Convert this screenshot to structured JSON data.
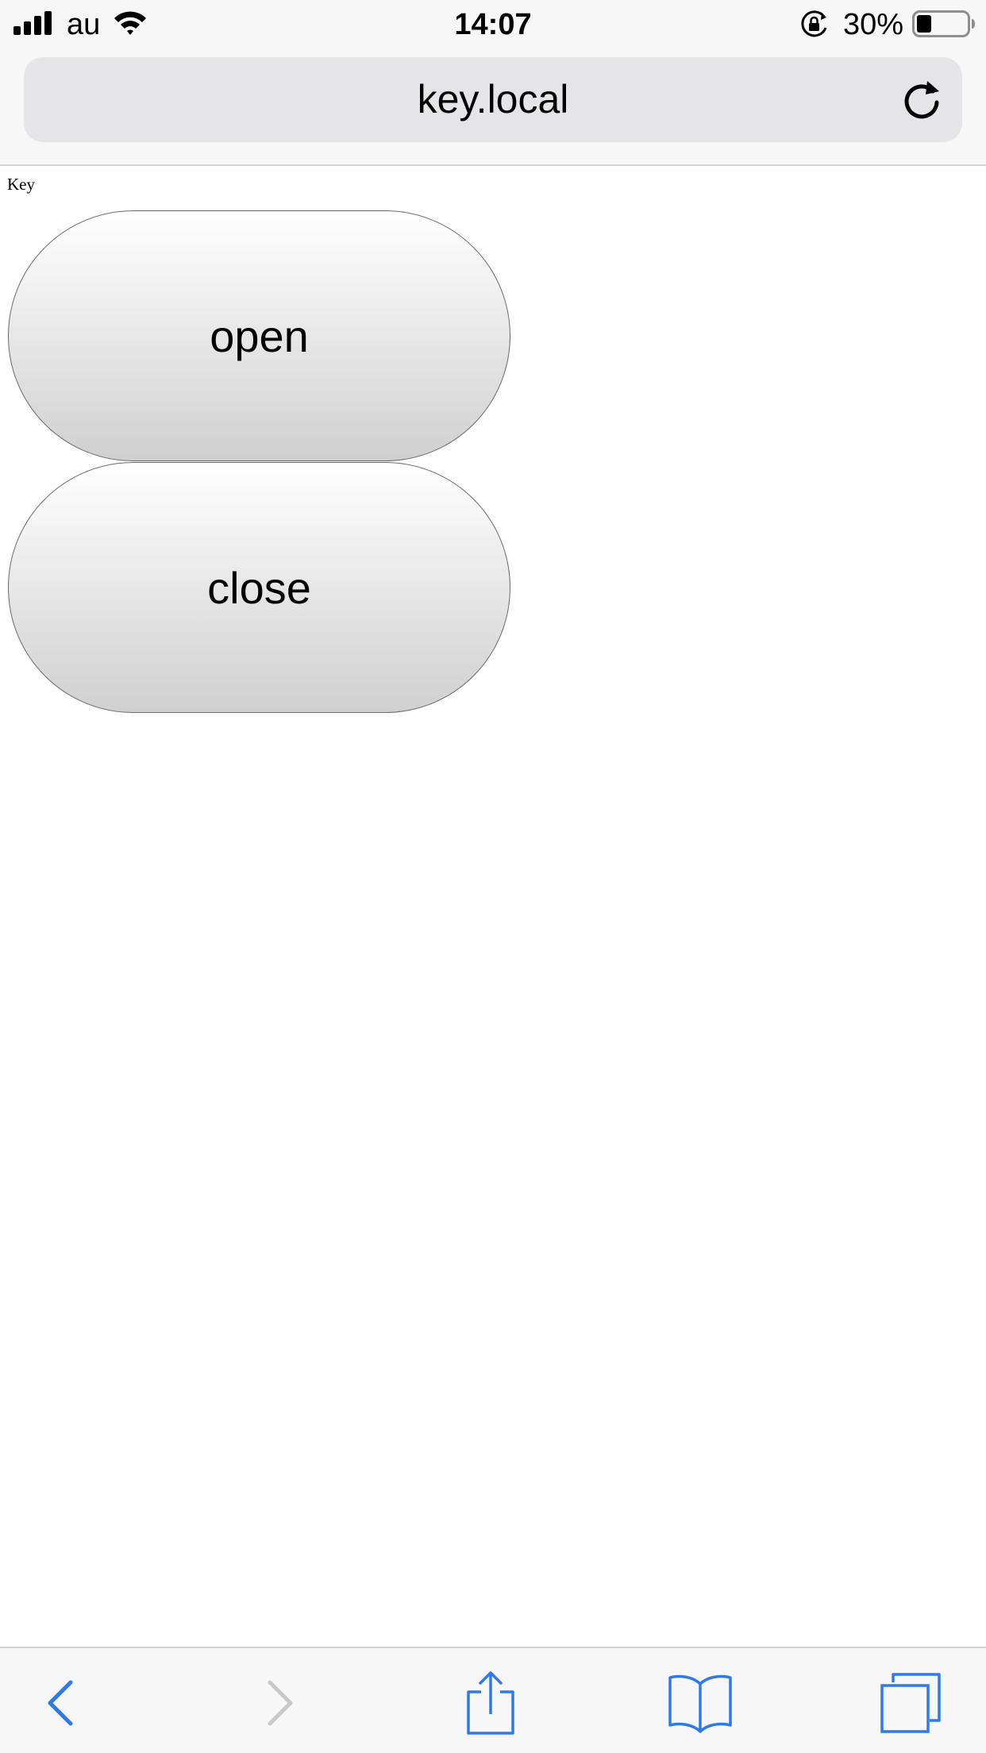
{
  "status_bar": {
    "carrier": "au",
    "time": "14:07",
    "battery_percent": "30%",
    "battery_level": 0.3,
    "icons": [
      "signal-bars-icon",
      "wifi-icon",
      "orientation-lock-icon",
      "battery-icon"
    ]
  },
  "address_bar": {
    "url": "key.local",
    "reload_icon": "reload-icon"
  },
  "page": {
    "heading": "Key",
    "buttons": {
      "open_label": "open",
      "close_label": "close"
    }
  },
  "toolbar": {
    "icons": [
      "back-icon",
      "forward-icon",
      "share-icon",
      "bookmarks-icon",
      "tabs-icon"
    ],
    "accent_color": "#2f7ae5",
    "disabled_color": "#c9c9c9"
  }
}
